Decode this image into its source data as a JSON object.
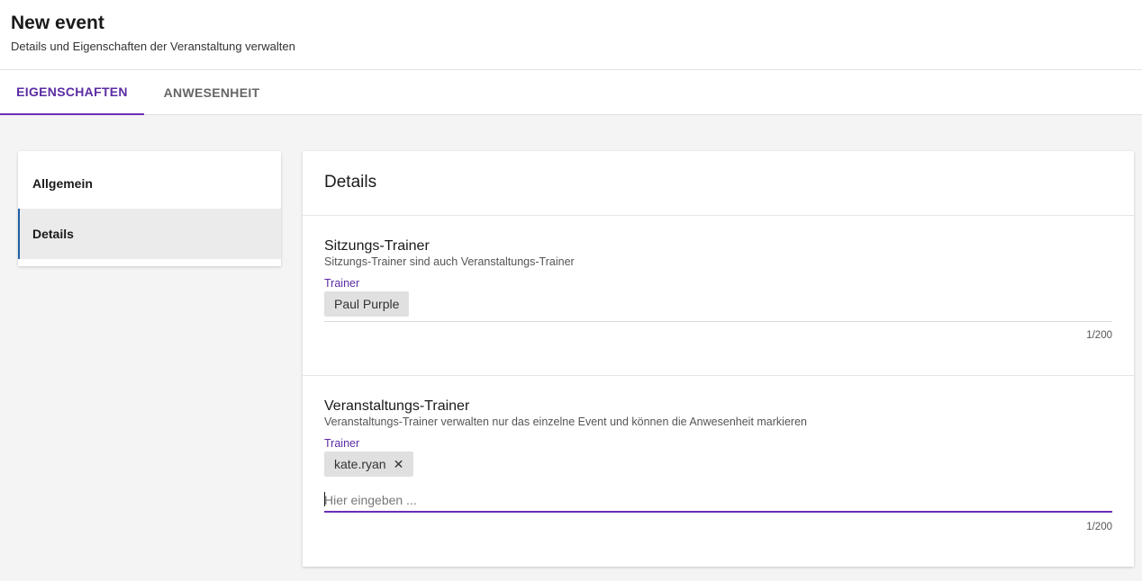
{
  "header": {
    "title": "New event",
    "subtitle": "Details und Eigenschaften der Veranstaltung verwalten"
  },
  "tabs": [
    {
      "label": "EIGENSCHAFTEN",
      "active": true
    },
    {
      "label": "ANWESENHEIT",
      "active": false
    }
  ],
  "sidenav": {
    "items": [
      {
        "label": "Allgemein",
        "active": false
      },
      {
        "label": "Details",
        "active": true
      }
    ]
  },
  "card": {
    "title": "Details",
    "sections": [
      {
        "title": "Sitzungs-Trainer",
        "description": "Sitzungs-Trainer sind auch Veranstaltungs-Trainer",
        "field_label": "Trainer",
        "chips": [
          "Paul Purple"
        ],
        "counter": "1/200"
      },
      {
        "title": "Veranstaltungs-Trainer",
        "description": "Veranstaltungs-Trainer verwalten nur das einzelne Event und können die Anwesenheit markieren",
        "field_label": "Trainer",
        "chips": [
          "kate.ryan"
        ],
        "chip_remove_glyph": "✕",
        "input_placeholder": "Hier eingeben ...",
        "input_value": "",
        "counter": "1/200"
      }
    ]
  },
  "colors": {
    "accent": "#6b2fb8",
    "accent_text": "#5b2ca3",
    "nav_active_border": "#1f5fa6",
    "background": "#f4f4f4"
  }
}
